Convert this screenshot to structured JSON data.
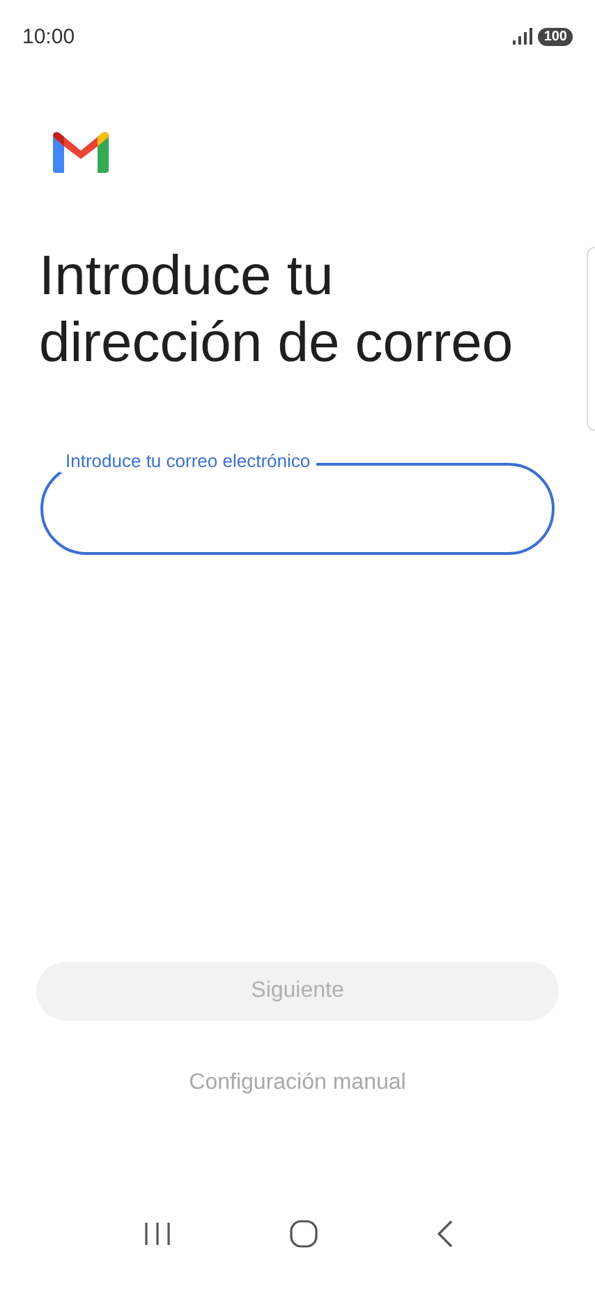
{
  "status_bar": {
    "time": "10:00",
    "battery": "100"
  },
  "heading": "Introduce tu dirección de correo",
  "email_field": {
    "placeholder": "Introduce tu correo electrónico",
    "focused": true
  },
  "next_button": {
    "label": "Siguiente",
    "disabled": true
  },
  "manual_link": {
    "label": "Configuración manual",
    "disabled": true
  }
}
